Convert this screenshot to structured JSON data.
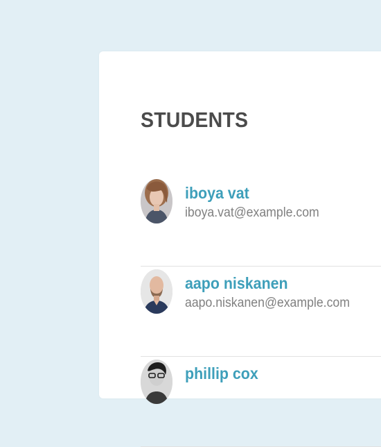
{
  "heading": "STUDENTS",
  "students": [
    {
      "name": "iboya vat",
      "email": "iboya.vat@example.com",
      "avatar_icon": "person-photo-icon"
    },
    {
      "name": "aapo niskanen",
      "email": "aapo.niskanen@example.com",
      "avatar_icon": "person-photo-icon"
    },
    {
      "name": "phillip cox",
      "email": "",
      "avatar_icon": "person-photo-icon"
    }
  ],
  "colors": {
    "background": "#e2eff5",
    "card": "#ffffff",
    "heading": "#4b4b4b",
    "name": "#3e9fba",
    "email": "#808080",
    "divider": "#e1e1e1"
  }
}
